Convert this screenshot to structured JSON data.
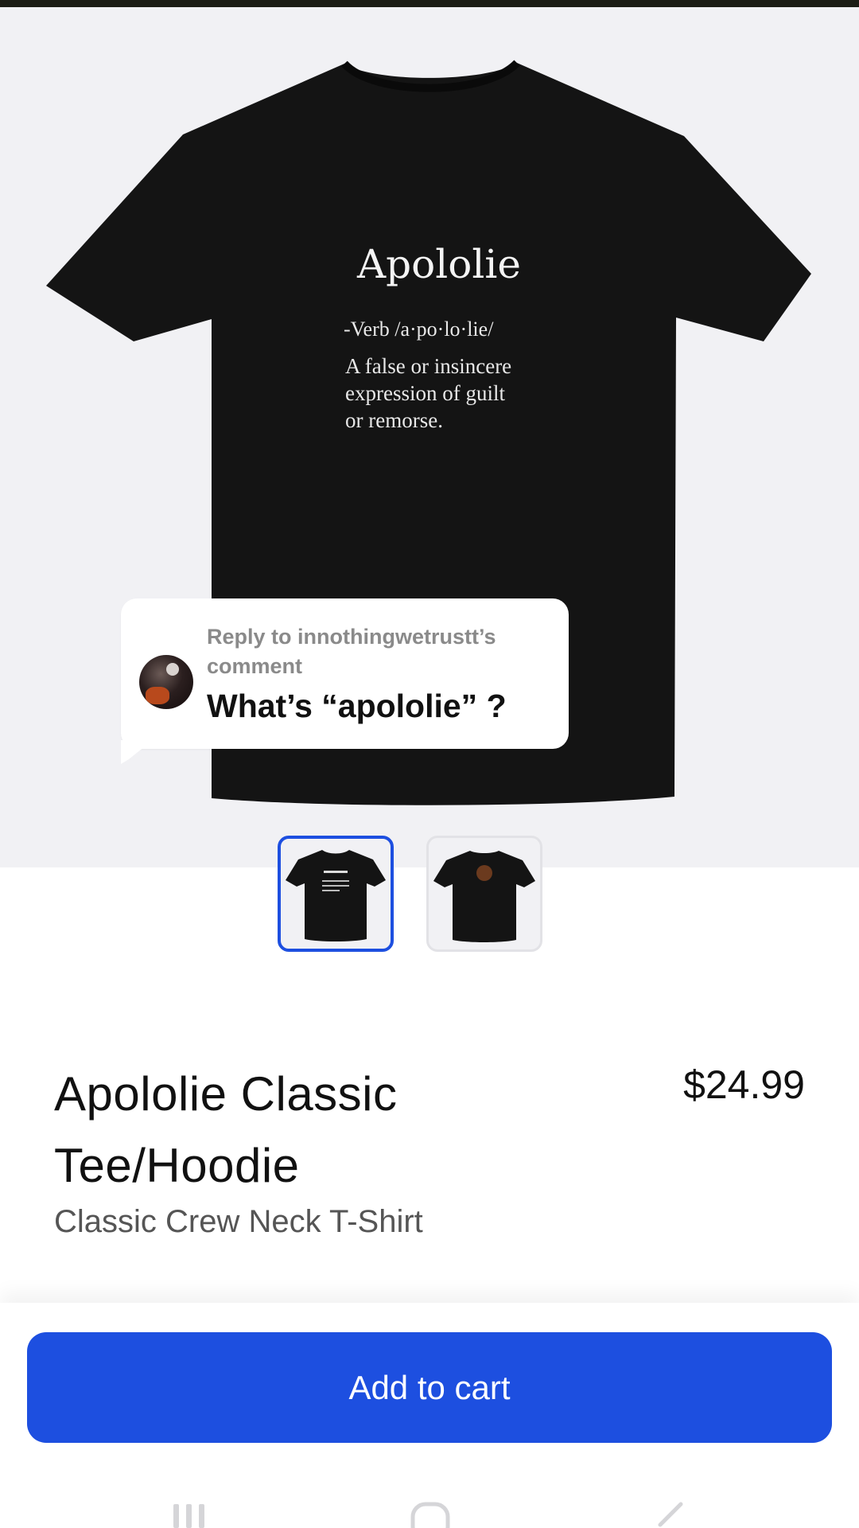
{
  "reply": {
    "header": "Reply to innothingwetrustt’s comment",
    "text": "What’s “apololie” ?"
  },
  "shirt_print": {
    "title": "Apololie",
    "pronunciation": "-Verb /a·po·lo·lie/",
    "definition_lines": [
      "A false or insincere",
      "expression of guilt",
      "or remorse."
    ]
  },
  "thumbnails": [
    {
      "name": "front view",
      "selected": true
    },
    {
      "name": "back view",
      "selected": false
    }
  ],
  "product": {
    "title": "Apololie Classic Tee/Hoodie",
    "price": "$24.99",
    "subtitle": "Classic Crew Neck T-Shirt"
  },
  "cart": {
    "button_label": "Add to cart"
  },
  "nav": {
    "icons": [
      "recent-apps-icon",
      "home-icon",
      "back-icon"
    ]
  },
  "colors": {
    "accent": "#1d4fe0",
    "shirt": "#141414",
    "hero_background": "#f1f1f4"
  }
}
